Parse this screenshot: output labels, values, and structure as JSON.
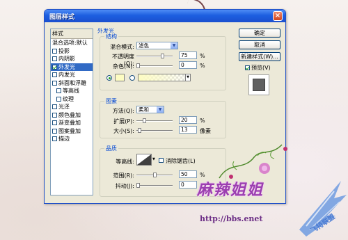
{
  "window": {
    "title": "图层样式",
    "close_label": "×"
  },
  "style_list": {
    "header": "样式",
    "items": [
      {
        "label": "混合选项:默认",
        "checkbox": false,
        "checked": false,
        "selected": false,
        "indent": false
      },
      {
        "label": "投影",
        "checkbox": true,
        "checked": false,
        "selected": false,
        "indent": false
      },
      {
        "label": "内阴影",
        "checkbox": true,
        "checked": false,
        "selected": false,
        "indent": false
      },
      {
        "label": "外发光",
        "checkbox": true,
        "checked": true,
        "selected": true,
        "indent": false
      },
      {
        "label": "内发光",
        "checkbox": true,
        "checked": false,
        "selected": false,
        "indent": false
      },
      {
        "label": "斜面和浮雕",
        "checkbox": true,
        "checked": false,
        "selected": false,
        "indent": false
      },
      {
        "label": "等高线",
        "checkbox": true,
        "checked": false,
        "selected": false,
        "indent": true
      },
      {
        "label": "纹理",
        "checkbox": true,
        "checked": false,
        "selected": false,
        "indent": true
      },
      {
        "label": "光泽",
        "checkbox": true,
        "checked": false,
        "selected": false,
        "indent": false
      },
      {
        "label": "颜色叠加",
        "checkbox": true,
        "checked": false,
        "selected": false,
        "indent": false
      },
      {
        "label": "渐变叠加",
        "checkbox": true,
        "checked": false,
        "selected": false,
        "indent": false
      },
      {
        "label": "图案叠加",
        "checkbox": true,
        "checked": false,
        "selected": false,
        "indent": false
      },
      {
        "label": "描边",
        "checkbox": true,
        "checked": false,
        "selected": false,
        "indent": false
      }
    ]
  },
  "panel": {
    "section_title": "外发光",
    "structure": {
      "label": "结构",
      "blend_mode_label": "混合模式:",
      "blend_mode_value": "滤色",
      "opacity_label": "不透明度(O):",
      "opacity_value": "75",
      "opacity_level": 0.75,
      "noise_label": "杂色(N):",
      "noise_value": "0",
      "noise_level": 0,
      "percent": "%",
      "color_hex": "#fdfcc2"
    },
    "elements": {
      "label": "图素",
      "method_label": "方法(Q):",
      "method_value": "柔和",
      "spread_label": "扩展(P):",
      "spread_value": "20",
      "spread_level": 0.2,
      "size_label": "大小(S):",
      "size_value": "13",
      "size_level": 0.052,
      "percent": "%",
      "px_unit": "像素"
    },
    "quality": {
      "label": "品质",
      "contour_label": "等高线:",
      "antialias_label": "消除锯齿(L)",
      "range_label": "范围(R):",
      "range_value": "50",
      "range_level": 0.5,
      "jitter_label": "抖动(J):",
      "jitter_value": "0",
      "jitter_level": 0,
      "percent": "%"
    }
  },
  "buttons": {
    "ok": "确定",
    "cancel": "取消",
    "new_style": "新建样式(W)...",
    "preview": "预览(V)"
  },
  "watermark": {
    "text": "麻辣姐姐",
    "url": "http://bbs.enet",
    "logo_text": "飞特联盟"
  },
  "colors": {
    "title_bar": "#1d5fe0",
    "dialog_bg": "#ece9d8",
    "selection": "#316ac5",
    "group_label": "#0046d5"
  }
}
